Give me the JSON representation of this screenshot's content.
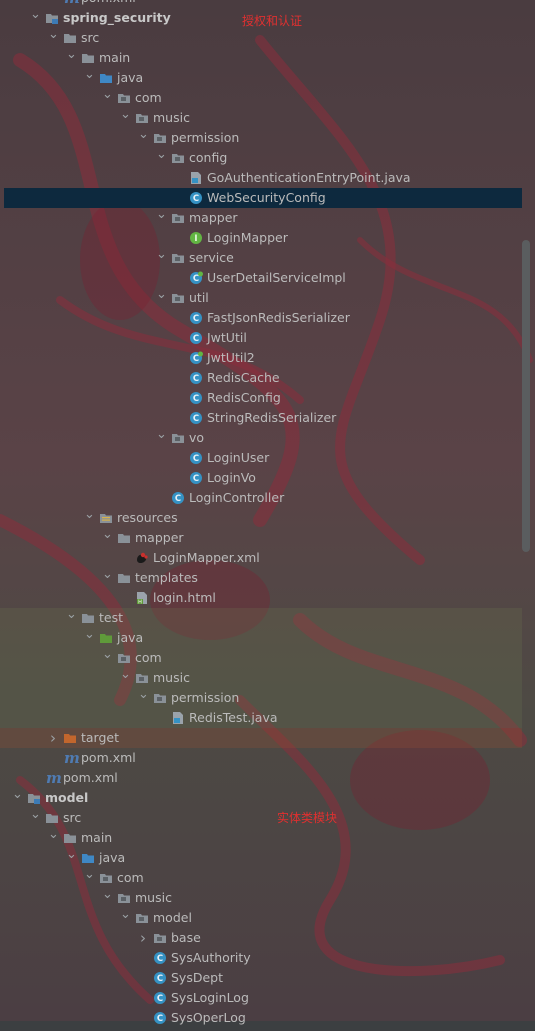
{
  "annotations": {
    "auth_note": "授权和认证",
    "entity_note": "实体类模块"
  },
  "tree": [
    {
      "label": "pom.xml",
      "depth": 3,
      "icon": "maven",
      "arrow": "none"
    },
    {
      "label": "spring_security",
      "depth": 2,
      "icon": "module-folder",
      "arrow": "down",
      "bold": true
    },
    {
      "label": "src",
      "depth": 3,
      "icon": "folder",
      "arrow": "down"
    },
    {
      "label": "main",
      "depth": 4,
      "icon": "folder",
      "arrow": "down"
    },
    {
      "label": "java",
      "depth": 5,
      "icon": "src-folder",
      "arrow": "down"
    },
    {
      "label": "com",
      "depth": 6,
      "icon": "package",
      "arrow": "down"
    },
    {
      "label": "music",
      "depth": 7,
      "icon": "package",
      "arrow": "down"
    },
    {
      "label": "permission",
      "depth": 8,
      "icon": "package",
      "arrow": "down"
    },
    {
      "label": "config",
      "depth": 9,
      "icon": "package",
      "arrow": "down"
    },
    {
      "label": "GoAuthenticationEntryPoint.java",
      "depth": 10,
      "icon": "java-file",
      "arrow": "none"
    },
    {
      "label": "WebSecurityConfig",
      "depth": 10,
      "icon": "class",
      "arrow": "none",
      "selected": true
    },
    {
      "label": "mapper",
      "depth": 9,
      "icon": "package",
      "arrow": "down"
    },
    {
      "label": "LoginMapper",
      "depth": 10,
      "icon": "interface",
      "arrow": "none"
    },
    {
      "label": "service",
      "depth": 9,
      "icon": "package",
      "arrow": "down"
    },
    {
      "label": "UserDetailServiceImpl",
      "depth": 10,
      "icon": "class-impl",
      "arrow": "none"
    },
    {
      "label": "util",
      "depth": 9,
      "icon": "package",
      "arrow": "down"
    },
    {
      "label": "FastJsonRedisSerializer",
      "depth": 10,
      "icon": "class",
      "arrow": "none"
    },
    {
      "label": "JwtUtil",
      "depth": 10,
      "icon": "class",
      "arrow": "none"
    },
    {
      "label": "JwtUtil2",
      "depth": 10,
      "icon": "class-impl",
      "arrow": "none"
    },
    {
      "label": "RedisCache",
      "depth": 10,
      "icon": "class",
      "arrow": "none"
    },
    {
      "label": "RedisConfig",
      "depth": 10,
      "icon": "class",
      "arrow": "none"
    },
    {
      "label": "StringRedisSerializer",
      "depth": 10,
      "icon": "class",
      "arrow": "none"
    },
    {
      "label": "vo",
      "depth": 9,
      "icon": "package",
      "arrow": "down"
    },
    {
      "label": "LoginUser",
      "depth": 10,
      "icon": "class",
      "arrow": "none"
    },
    {
      "label": "LoginVo",
      "depth": 10,
      "icon": "class",
      "arrow": "none"
    },
    {
      "label": "LoginController",
      "depth": 9,
      "icon": "class",
      "arrow": "none"
    },
    {
      "label": "resources",
      "depth": 5,
      "icon": "res-folder",
      "arrow": "down"
    },
    {
      "label": "mapper",
      "depth": 6,
      "icon": "folder",
      "arrow": "down"
    },
    {
      "label": "LoginMapper.xml",
      "depth": 7,
      "icon": "mybatis-xml",
      "arrow": "none"
    },
    {
      "label": "templates",
      "depth": 6,
      "icon": "folder",
      "arrow": "down"
    },
    {
      "label": "login.html",
      "depth": 7,
      "icon": "html-file",
      "arrow": "none"
    },
    {
      "label": "test",
      "depth": 4,
      "icon": "folder",
      "arrow": "down",
      "band": "test"
    },
    {
      "label": "java",
      "depth": 5,
      "icon": "test-folder",
      "arrow": "down",
      "band": "test"
    },
    {
      "label": "com",
      "depth": 6,
      "icon": "package",
      "arrow": "down",
      "band": "test"
    },
    {
      "label": "music",
      "depth": 7,
      "icon": "package",
      "arrow": "down",
      "band": "test"
    },
    {
      "label": "permission",
      "depth": 8,
      "icon": "package",
      "arrow": "down",
      "band": "test"
    },
    {
      "label": "RedisTest.java",
      "depth": 9,
      "icon": "java-file",
      "arrow": "none",
      "band": "test"
    },
    {
      "label": "target",
      "depth": 3,
      "icon": "target-folder",
      "arrow": "right",
      "band": "target"
    },
    {
      "label": "pom.xml",
      "depth": 3,
      "icon": "maven",
      "arrow": "none"
    },
    {
      "label": "pom.xml",
      "depth": 2,
      "icon": "maven",
      "arrow": "none"
    },
    {
      "label": "model",
      "depth": 1,
      "icon": "module-folder",
      "arrow": "down",
      "bold": true
    },
    {
      "label": "src",
      "depth": 2,
      "icon": "folder",
      "arrow": "down"
    },
    {
      "label": "main",
      "depth": 3,
      "icon": "folder",
      "arrow": "down"
    },
    {
      "label": "java",
      "depth": 4,
      "icon": "src-folder",
      "arrow": "down"
    },
    {
      "label": "com",
      "depth": 5,
      "icon": "package",
      "arrow": "down"
    },
    {
      "label": "music",
      "depth": 6,
      "icon": "package",
      "arrow": "down"
    },
    {
      "label": "model",
      "depth": 7,
      "icon": "package",
      "arrow": "down"
    },
    {
      "label": "base",
      "depth": 8,
      "icon": "package",
      "arrow": "right"
    },
    {
      "label": "SysAuthority",
      "depth": 8,
      "icon": "class",
      "arrow": "none"
    },
    {
      "label": "SysDept",
      "depth": 8,
      "icon": "class",
      "arrow": "none"
    },
    {
      "label": "SysLoginLog",
      "depth": 8,
      "icon": "class",
      "arrow": "none"
    },
    {
      "label": "SysOperLog",
      "depth": 8,
      "icon": "class",
      "arrow": "none"
    }
  ]
}
